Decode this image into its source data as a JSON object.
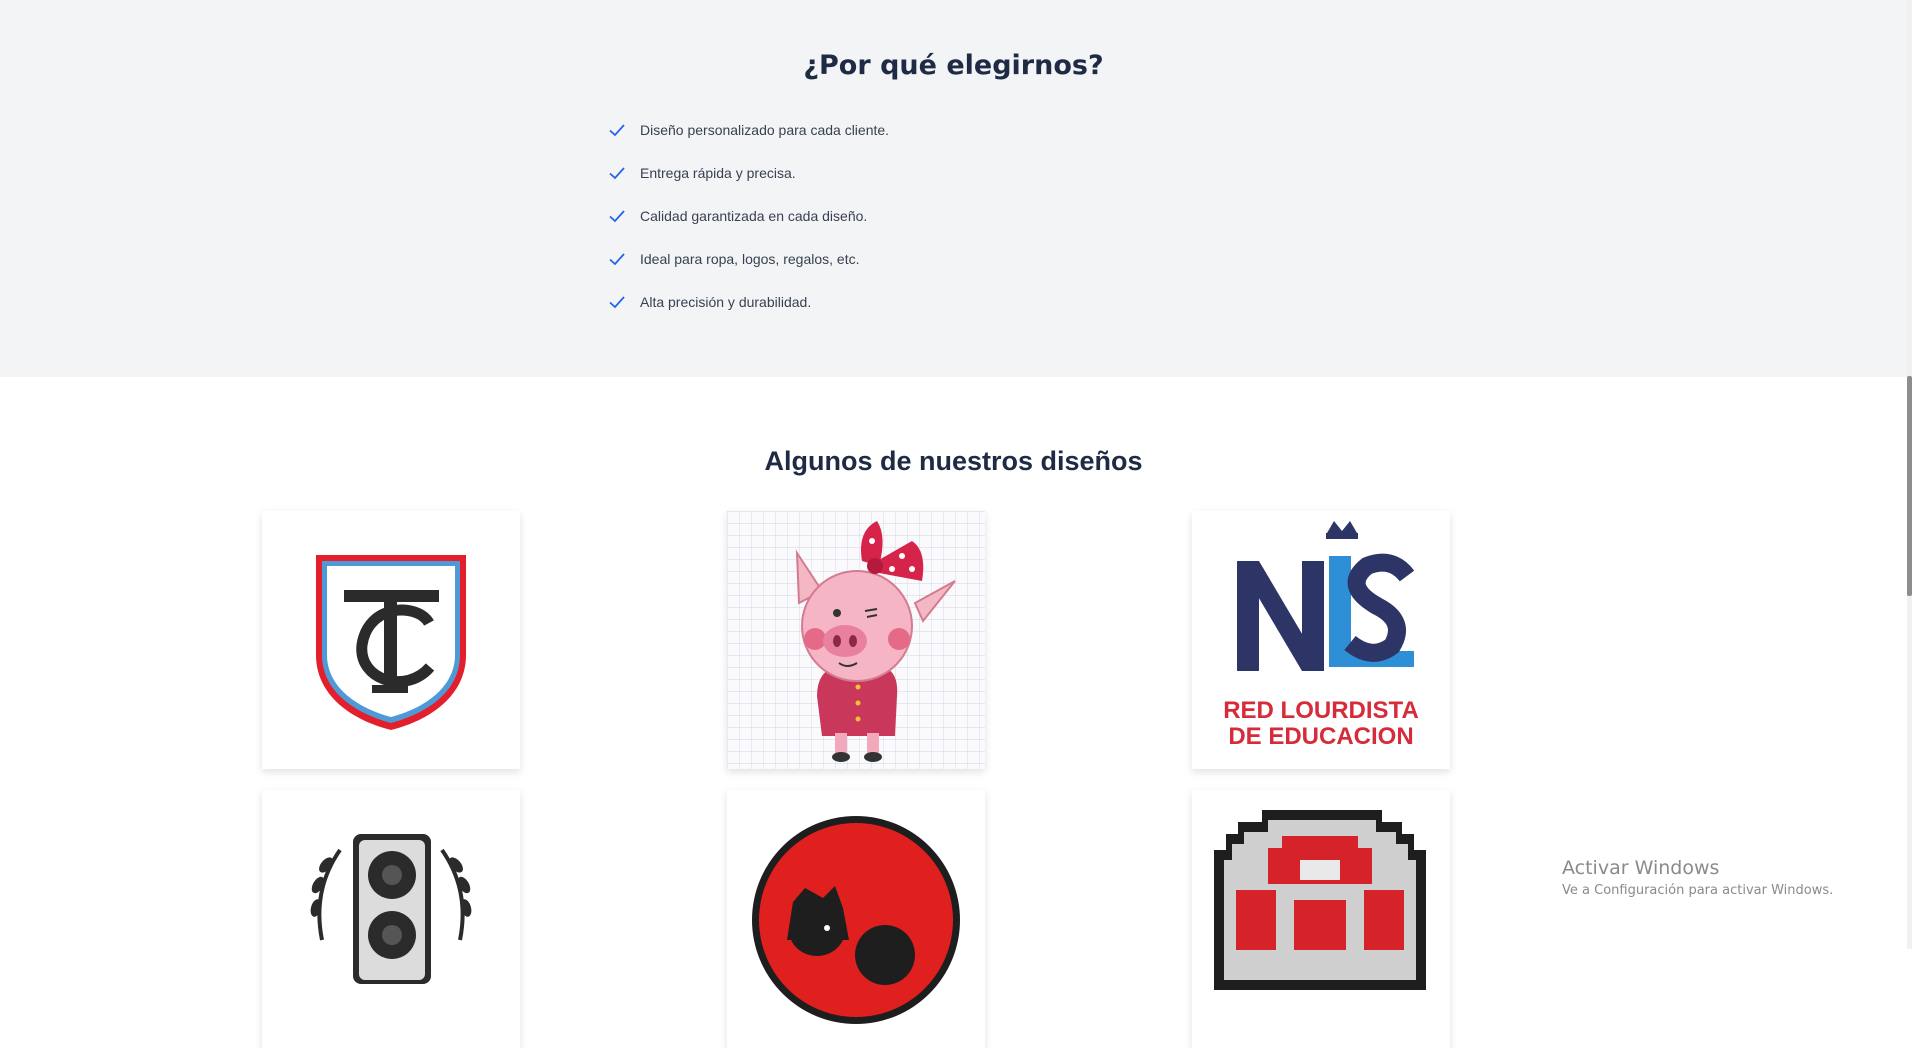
{
  "why": {
    "title": "¿Por qué elegirnos?",
    "items": [
      "Diseño personalizado para cada cliente.",
      "Entrega rápida y precisa.",
      "Calidad garantizada en cada diseño.",
      "Ideal para ropa, logos, regalos, etc.",
      "Alta precisión y durabilidad."
    ],
    "check_color": "#2563eb"
  },
  "designs": {
    "title": "Algunos de nuestros diseños",
    "cards": [
      {
        "name": "tc-shield-emblem"
      },
      {
        "name": "pig-with-bow-embroidery"
      },
      {
        "name": "nls-logo",
        "line1": "RED  LOURDISTA",
        "line2": "DE  EDUCACION"
      },
      {
        "name": "speaker-laurel-emblem"
      },
      {
        "name": "red-circle-character-patch"
      },
      {
        "name": "pixel-mushroom-patch"
      }
    ]
  },
  "watermark": {
    "title": "Activar Windows",
    "subtitle": "Ve a Configuración para activar Windows."
  }
}
